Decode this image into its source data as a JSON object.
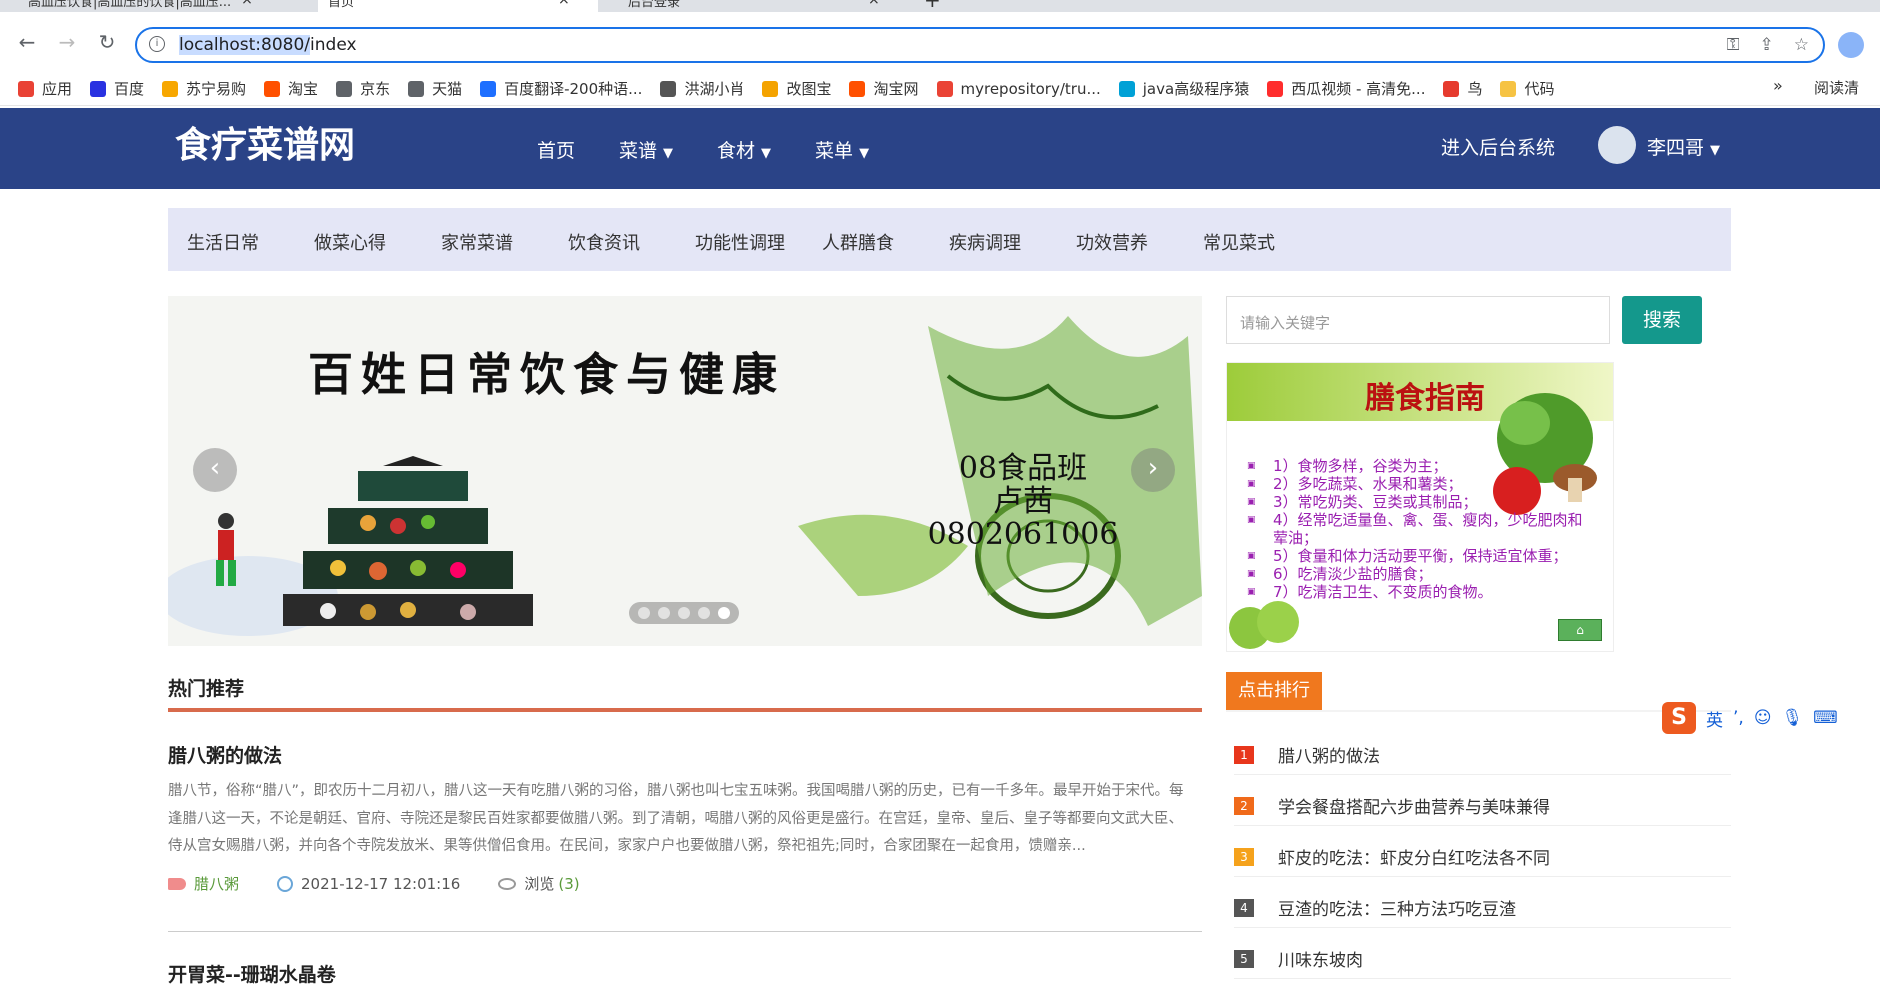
{
  "browser": {
    "tabs": [
      {
        "label": "高血压饮食|高血压的饮食|高血压..."
      },
      {
        "label": "首页"
      },
      {
        "label": "后台登录"
      }
    ],
    "url_host": "localhost:8080/",
    "url_path": "index",
    "bookmarks": [
      {
        "label": "应用",
        "color": "#e94235"
      },
      {
        "label": "百度",
        "color": "#2932e1"
      },
      {
        "label": "苏宁易购",
        "color": "#f7a700"
      },
      {
        "label": "淘宝",
        "color": "#ff5000"
      },
      {
        "label": "京东",
        "color": "#5f6368"
      },
      {
        "label": "天猫",
        "color": "#5f6368"
      },
      {
        "label": "百度翻译-200种语...",
        "color": "#1e6fff"
      },
      {
        "label": "洪湖小肖",
        "color": "#555"
      },
      {
        "label": "改图宝",
        "color": "#f4a300"
      },
      {
        "label": "淘宝网",
        "color": "#ff5000"
      },
      {
        "label": "myrepository/tru...",
        "color": "#ea4335"
      },
      {
        "label": "java高级程序猿",
        "color": "#00a1d6"
      },
      {
        "label": "西瓜视频 - 高清免...",
        "color": "#ff2d2d"
      },
      {
        "label": "鸟",
        "color": "#e63b2e"
      },
      {
        "label": "代码",
        "color": "#f6c343"
      }
    ],
    "bookmarks_more": "»",
    "reading_list": "阅读清"
  },
  "header": {
    "logo": "食疗菜谱网",
    "nav": [
      {
        "label": "首页",
        "dropdown": false
      },
      {
        "label": "菜谱",
        "dropdown": true
      },
      {
        "label": "食材",
        "dropdown": true
      },
      {
        "label": "菜单",
        "dropdown": true
      }
    ],
    "admin_link": "进入后台系统",
    "user_name": "李四哥"
  },
  "categories": [
    "生活日常",
    "做菜心得",
    "家常菜谱",
    "饮食资讯",
    "功能性调理",
    "人群膳食",
    "疾病调理",
    "功效营养",
    "常见菜式"
  ],
  "carousel": {
    "headline": "百姓日常饮食与健康",
    "class_lines": [
      "08食品班",
      "卢茜",
      "0802061006"
    ],
    "prev": "‹",
    "next": "›",
    "slide_count": 5,
    "active_slide": 5
  },
  "search": {
    "placeholder": "请输入关键字",
    "button": "搜索"
  },
  "guide": {
    "title": "膳食指南",
    "lines": [
      "1）食物多样，谷类为主；",
      "2）多吃蔬菜、水果和薯类；",
      "3）常吃奶类、豆类或其制品；",
      "4）经常吃适量鱼、禽、蛋、瘦肉，少吃肥肉和荤油；",
      "5）食量和体力活动要平衡，保持适宜体重；",
      "6）吃清淡少盐的膳食；",
      "7）吃清洁卫生、不变质的食物。"
    ]
  },
  "hot": {
    "title": "热门推荐",
    "posts": [
      {
        "title": "腊八粥的做法",
        "body": "腊八节，俗称“腊八”，即农历十二月初八，腊八这一天有吃腊八粥的习俗，腊八粥也叫七宝五味粥。我国喝腊八粥的历史，已有一千多年。最早开始于宋代。每逢腊八这一天，不论是朝廷、官府、寺院还是黎民百姓家都要做腊八粥。到了清朝，喝腊八粥的风俗更是盛行。在宫廷，皇帝、皇后、皇子等都要向文武大臣、侍从宫女赐腊八粥，并向各个寺院发放米、果等供僧侣食用。在民间，家家户户也要做腊八粥，祭祀祖先;同时，合家团聚在一起食用，馈赠亲...",
        "tag": "腊八粥",
        "date": "2021-12-17 12:01:16",
        "views_label": "浏览",
        "views": "(3)"
      },
      {
        "title": "开胃菜--珊瑚水晶卷"
      }
    ]
  },
  "ranking": {
    "title": "点击排行",
    "items": [
      {
        "num": "1",
        "title": "腊八粥的做法",
        "color": "#e8361c"
      },
      {
        "num": "2",
        "title": "学会餐盘搭配六步曲营养与美味兼得",
        "color": "#f06a1a"
      },
      {
        "num": "3",
        "title": "虾皮的吃法：虾皮分白红吃法各不同",
        "color": "#f5a21c"
      },
      {
        "num": "4",
        "title": "豆渣的吃法：三种方法巧吃豆渣",
        "color": "#555555"
      },
      {
        "num": "5",
        "title": "川味东坡肉",
        "color": "#555555"
      }
    ]
  },
  "ime": {
    "logo": "S",
    "mode": "英"
  }
}
